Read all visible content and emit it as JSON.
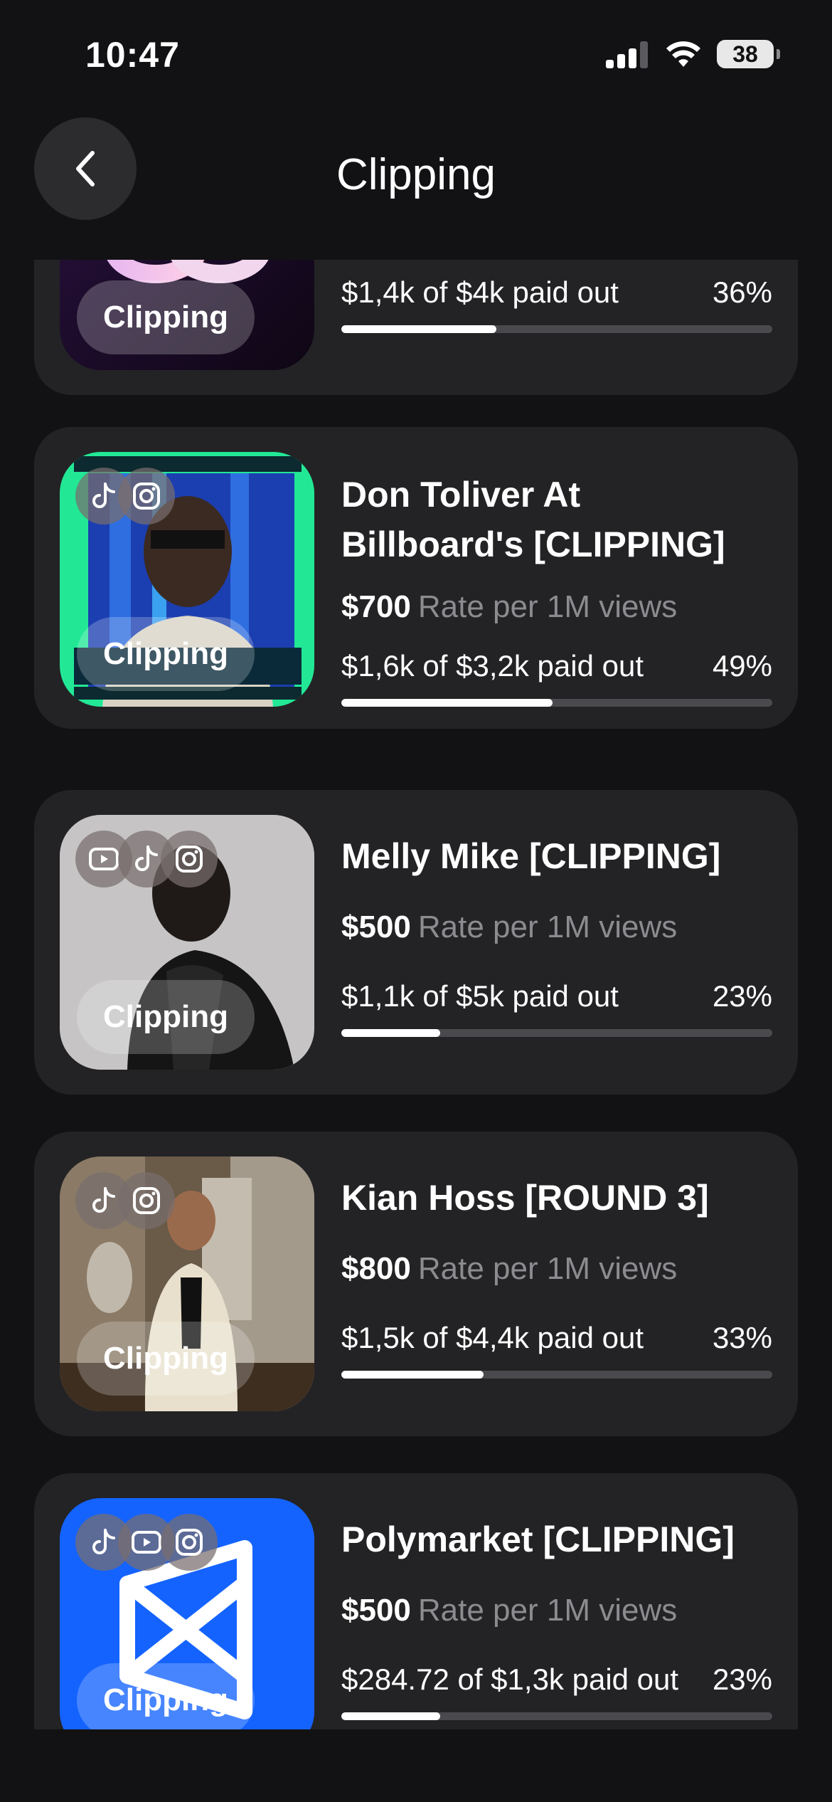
{
  "status_bar": {
    "time": "10:47",
    "battery": "38"
  },
  "header": {
    "title": "Clipping"
  },
  "campaigns": [
    {
      "title": "",
      "rate_amount": "",
      "rate_label": "",
      "payout_text": "$1,4k of $4k paid out",
      "percent_text": "36%",
      "progress": 0.36,
      "tag": "Clipping",
      "platforms": []
    },
    {
      "title": " Don Toliver At Billboard's [CLIPPING]",
      "rate_amount": "$700",
      "rate_label": "Rate per 1M views",
      "payout_text": "$1,6k of $3,2k paid out",
      "percent_text": "49%",
      "progress": 0.49,
      "tag": "Clipping",
      "platforms": [
        "tiktok-icon",
        "instagram-icon"
      ]
    },
    {
      "title": "Melly Mike [CLIPPING]",
      "rate_amount": "$500",
      "rate_label": "Rate per 1M views",
      "payout_text": "$1,1k of $5k paid out",
      "percent_text": "23%",
      "progress": 0.23,
      "tag": "Clipping",
      "platforms": [
        "youtube-icon",
        "tiktok-icon",
        "instagram-icon"
      ]
    },
    {
      "title": "Kian Hoss [ROUND 3]",
      "rate_amount": "$800",
      "rate_label": "Rate per 1M views",
      "payout_text": "$1,5k of $4,4k paid out",
      "percent_text": "33%",
      "progress": 0.33,
      "tag": "Clipping",
      "platforms": [
        "tiktok-icon",
        "instagram-icon"
      ]
    },
    {
      "title": "Polymarket [CLIPPING]",
      "rate_amount": "$500",
      "rate_label": "Rate per 1M views",
      "payout_text": "$284.72 of $1,3k paid out",
      "percent_text": "23%",
      "progress": 0.23,
      "tag": "Clipping",
      "platforms": [
        "tiktok-icon",
        "youtube-icon",
        "instagram-icon"
      ]
    }
  ],
  "colors": {
    "background": "#121214",
    "card": "#232325",
    "polymarket_blue": "#1463ff"
  }
}
